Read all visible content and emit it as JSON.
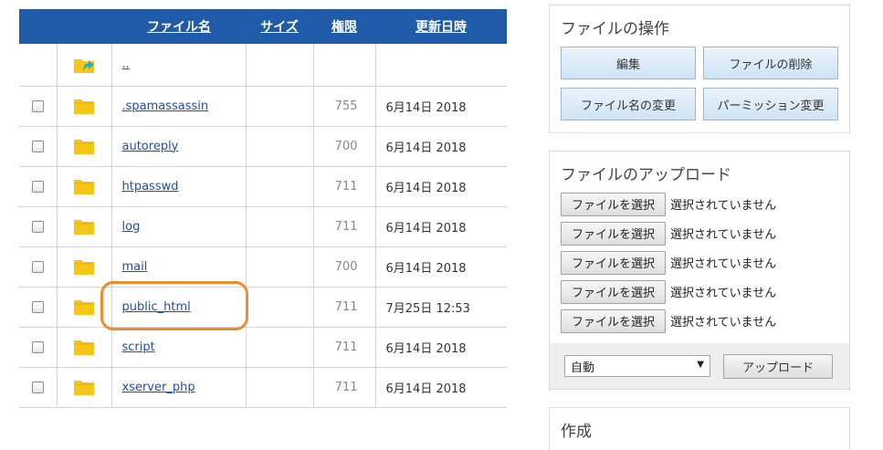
{
  "table": {
    "headers": {
      "name": "ファイル名",
      "size": "サイズ",
      "permission": "権限",
      "modified": "更新日時"
    },
    "parent_link": "..",
    "rows": [
      {
        "name": ".spamassassin",
        "permission": "755",
        "date": "6月14日 2018"
      },
      {
        "name": "autoreply",
        "permission": "700",
        "date": "6月14日 2018"
      },
      {
        "name": "htpasswd",
        "permission": "711",
        "date": "6月14日 2018"
      },
      {
        "name": "log",
        "permission": "711",
        "date": "6月14日 2018"
      },
      {
        "name": "mail",
        "permission": "700",
        "date": "6月14日 2018"
      },
      {
        "name": "public_html",
        "permission": "711",
        "date": "7月25日 12:53"
      },
      {
        "name": "script",
        "permission": "711",
        "date": "6月14日 2018"
      },
      {
        "name": "xserver_php",
        "permission": "711",
        "date": "6月14日 2018"
      }
    ]
  },
  "operations": {
    "title": "ファイルの操作",
    "edit": "編集",
    "delete": "ファイルの削除",
    "rename": "ファイル名の変更",
    "permission": "パーミッション変更"
  },
  "upload": {
    "title": "ファイルのアップロード",
    "choose_label": "ファイルを選択",
    "no_file_label": "選択されていません",
    "mode": "自動",
    "upload_button": "アップロード"
  },
  "create": {
    "title": "作成"
  },
  "colors": {
    "header_bg": "#1f5ba8",
    "link": "#1a4fb0",
    "highlight": "#f08a2b",
    "folder": "#f5c518"
  }
}
